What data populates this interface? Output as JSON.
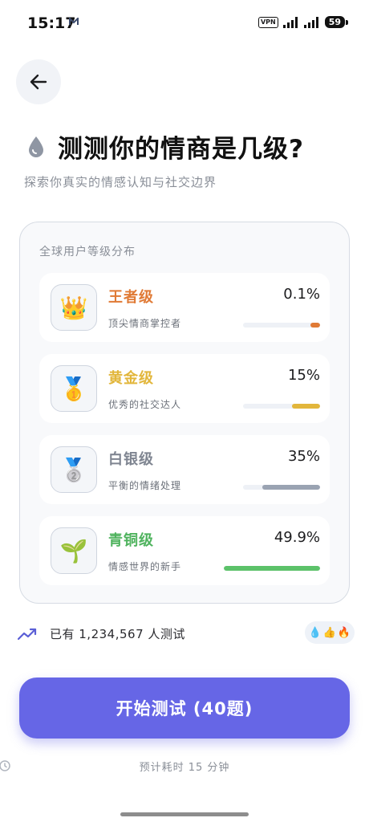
{
  "status_bar": {
    "time": "15:17",
    "vpn": "VPN",
    "battery": "59"
  },
  "header": {
    "title": "测测你的情商是几级?",
    "subtitle": "探索你真实的情感认知与社交边界"
  },
  "distribution": {
    "heading": "全球用户等级分布",
    "levels": [
      {
        "name": "王者级",
        "desc": "顶尖情商掌控者",
        "percent": "0.1%",
        "fill": 0.12,
        "color": "#e07a35",
        "icon": "crown-icon",
        "glyph": "👑"
      },
      {
        "name": "黄金级",
        "desc": "优秀的社交达人",
        "percent": "15%",
        "fill": 0.36,
        "color": "#e2b63b",
        "icon": "gold-medal-icon",
        "glyph": "🥇"
      },
      {
        "name": "白银级",
        "desc": "平衡的情绪处理",
        "percent": "35%",
        "fill": 0.75,
        "color": "#9aa3b2",
        "icon": "silver-medal-icon",
        "glyph": "🥈"
      },
      {
        "name": "青铜级",
        "desc": "情感世界的新手",
        "percent": "49.9%",
        "fill": 1.0,
        "color": "#5cc26a",
        "icon": "sprout-icon",
        "glyph": "🌱"
      }
    ],
    "name_colors": [
      "#e07a35",
      "#e2b63b",
      "#7f8591",
      "#4fb35e"
    ]
  },
  "stats": {
    "tested_text": "已有 1,234,567 人测试",
    "badges": [
      "💧",
      "👍",
      "🔥"
    ]
  },
  "actions": {
    "start_label": "开始测试 (40题)",
    "estimate_text": "预计耗时 15 分钟"
  }
}
